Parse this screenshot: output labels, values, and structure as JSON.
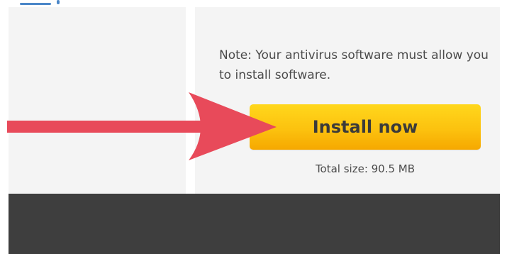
{
  "note_text": "Note: Your antivirus software must allow you to install software.",
  "install_button_label": "Install now",
  "total_size_text": "Total size: 90.5 MB",
  "colors": {
    "button_top": "#ffd71c",
    "button_bottom": "#f6a800",
    "arrow": "#e84a5a",
    "footer": "#3e3e3e",
    "panel": "#f4f4f4"
  },
  "icons": {
    "annotation_arrow": "right-arrow-icon"
  }
}
